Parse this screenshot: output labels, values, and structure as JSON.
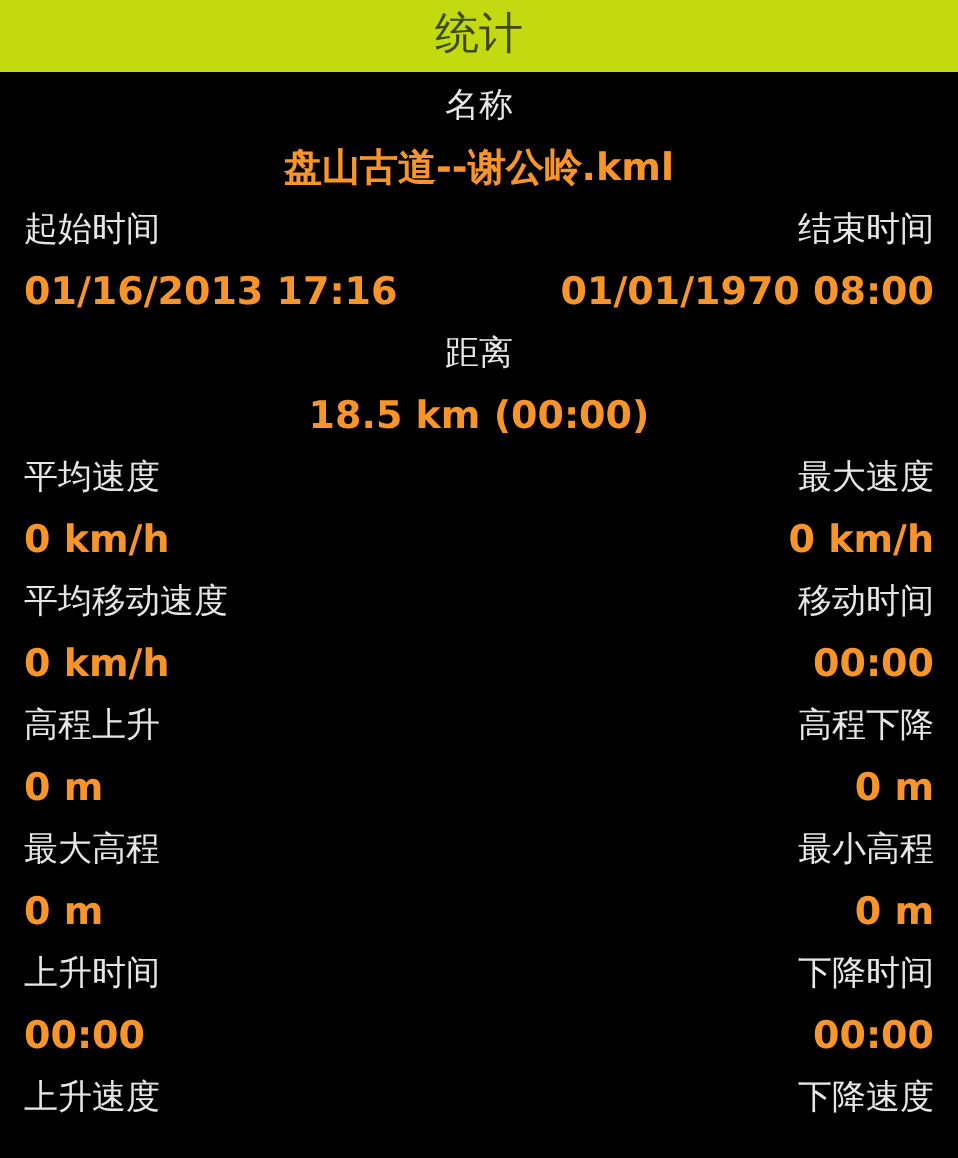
{
  "title": "统计",
  "stats": [
    {
      "kind": "center",
      "label": "名称",
      "value": "盘山古道--谢公岭.kml"
    },
    {
      "kind": "pair",
      "left": {
        "label": "起始时间",
        "value": "01/16/2013 17:16"
      },
      "right": {
        "label": "结束时间",
        "value": "01/01/1970 08:00"
      }
    },
    {
      "kind": "center",
      "label": "距离",
      "value": "18.5 km (00:00)"
    },
    {
      "kind": "pair",
      "left": {
        "label": "平均速度",
        "value": "0 km/h"
      },
      "right": {
        "label": "最大速度",
        "value": "0 km/h"
      }
    },
    {
      "kind": "pair",
      "left": {
        "label": "平均移动速度",
        "value": "0 km/h"
      },
      "right": {
        "label": "移动时间",
        "value": "00:00"
      }
    },
    {
      "kind": "pair",
      "left": {
        "label": "高程上升",
        "value": "0 m"
      },
      "right": {
        "label": "高程下降",
        "value": "0 m"
      }
    },
    {
      "kind": "pair",
      "left": {
        "label": "最大高程",
        "value": "0 m"
      },
      "right": {
        "label": "最小高程",
        "value": "0 m"
      }
    },
    {
      "kind": "pair",
      "left": {
        "label": "上升时间",
        "value": "00:00"
      },
      "right": {
        "label": "下降时间",
        "value": "00:00"
      }
    },
    {
      "kind": "pair",
      "left": {
        "label": "上升速度"
      },
      "right": {
        "label": "下降速度"
      }
    }
  ]
}
